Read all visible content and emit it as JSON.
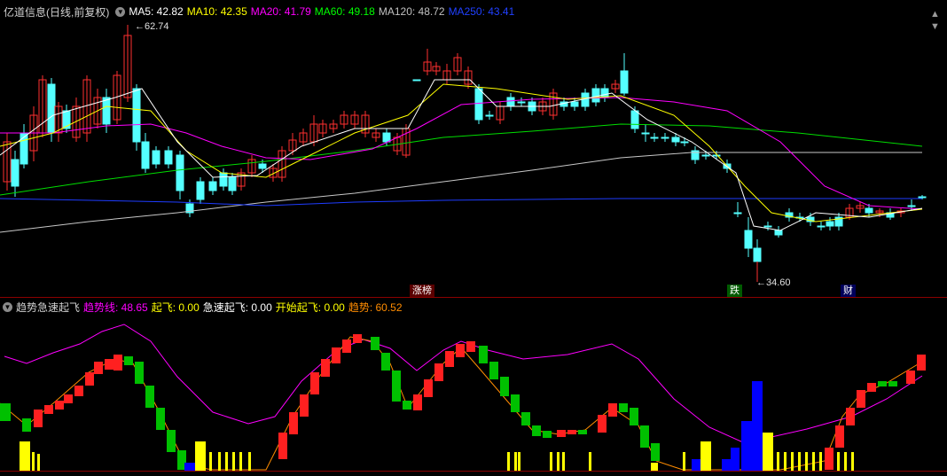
{
  "main": {
    "title": "亿道信息(日线,前复权)",
    "ma": [
      {
        "label": "MA5: 42.82",
        "color": "#ffffff"
      },
      {
        "label": "MA10: 42.35",
        "color": "#ffff00"
      },
      {
        "label": "MA20: 41.79",
        "color": "#ff00ff"
      },
      {
        "label": "MA60: 49.18",
        "color": "#00ff00"
      },
      {
        "label": "MA120: 48.72",
        "color": "#c0c0c0"
      },
      {
        "label": "MA250: 43.41",
        "color": "#0000ff"
      }
    ],
    "high_label": "62.74",
    "low_label": "34.60",
    "events": [
      {
        "text": "涨榜",
        "color": "#ffffff",
        "bg": "#5a0000"
      },
      {
        "text": "跌",
        "color": "#ffffff",
        "bg": "#005a00"
      },
      {
        "text": "财",
        "color": "#ffffff",
        "bg": "#00005a"
      }
    ]
  },
  "indicator": {
    "title": "趋势急速起飞",
    "values": [
      {
        "label": "趋势线: 48.65",
        "color": "#ff00ff"
      },
      {
        "label": "起飞: 0.00",
        "color": "#ffff00"
      },
      {
        "label": "急速起飞: 0.00",
        "color": "#ffffff"
      },
      {
        "label": "开始起飞: 0.00",
        "color": "#ffff00"
      },
      {
        "label": "趋势: 60.52",
        "color": "#ff8c00"
      }
    ]
  },
  "window_controls": {
    "up": "▲",
    "down": "▼"
  },
  "colors": {
    "up": "#ff3030",
    "down": "#54ffff",
    "grid": "#8b0000"
  }
}
